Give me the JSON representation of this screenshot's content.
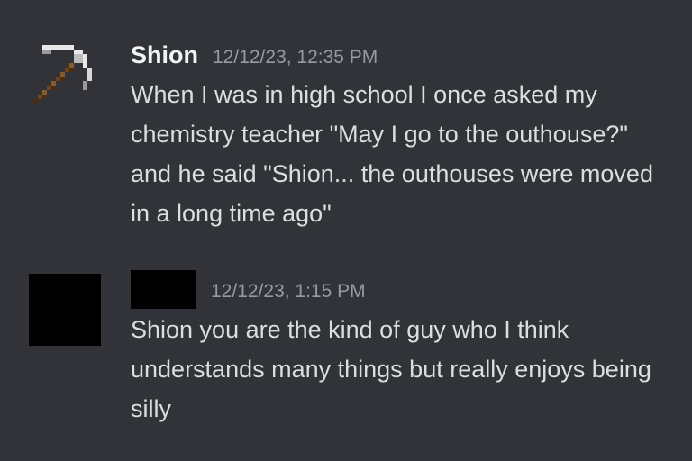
{
  "theme": {
    "background": "#313338",
    "username_color": "#f2f3f5",
    "timestamp_color": "#949ba4",
    "text_color": "#dbdee1",
    "redaction_color": "#000000"
  },
  "messages": [
    {
      "author": "Shion",
      "avatar_icon": "pickaxe-icon",
      "timestamp": "12/12/23, 12:35 PM",
      "text": "When I was in high school I once asked my chemistry teacher \"May I go to the outhouse?\" and he said \"Shion... the outhouses were moved in a long time ago\""
    },
    {
      "author": "",
      "avatar_icon": "redacted-avatar",
      "timestamp": "12/12/23, 1:15 PM",
      "text": "Shion you are the kind of guy who I think understands many things but really enjoys being silly"
    }
  ]
}
